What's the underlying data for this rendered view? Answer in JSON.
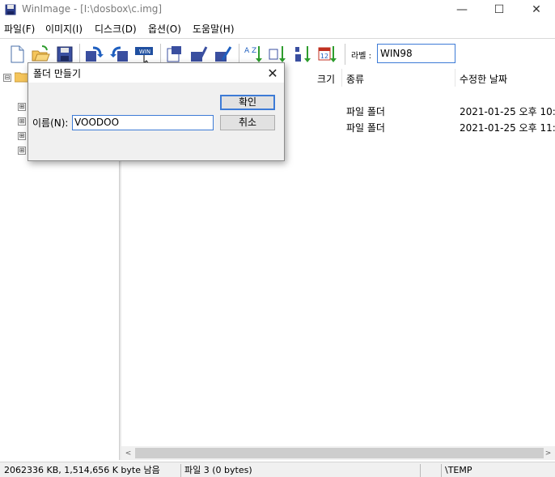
{
  "window": {
    "title": "WinImage - [I:\\dosbox\\c.img]",
    "minimize_glyph": "—",
    "maximize_glyph": "☐",
    "close_glyph": "✕"
  },
  "menu": [
    "파일(F)",
    "이미지(I)",
    "디스크(D)",
    "옵션(O)",
    "도움말(H)"
  ],
  "toolbar": {
    "icons": [
      "new-document-icon",
      "open-folder-icon",
      "save-disk-icon",
      "read-disk-icon",
      "write-disk-icon",
      "format-write-icon",
      "extract-icon",
      "inject-icon",
      "edit-icon",
      "properties-icon",
      "sort-az-icon",
      "sort-type-icon",
      "sort-size-icon",
      "sort-date-icon"
    ],
    "sort_az_text": "A Z",
    "sort_date_text": "12",
    "label_caption": "라벨 :",
    "label_value": "WIN98"
  },
  "list": {
    "columns": {
      "size": "크기",
      "type": "종류",
      "modified": "수정한 날짜"
    },
    "rows": [
      {
        "type": "파일 폴더",
        "modified": "2021-01-25  오후 10:"
      },
      {
        "type": "파일 폴더",
        "modified": "2021-01-25  오후 11:"
      }
    ]
  },
  "tree": {
    "expanders": [
      "⊟",
      "⊞",
      "⊞",
      "⊞",
      "⊞"
    ]
  },
  "scroll": {
    "left_arrow": "<",
    "right_arrow": ">"
  },
  "status": {
    "free_space": "2062336 KB, 1,514,656 K byte 남음",
    "file_count": "파일 3 (0 bytes)",
    "path": "\\TEMP"
  },
  "dialog": {
    "title": "폴더 만들기",
    "close_glyph": "✕",
    "name_label": "이름(N):",
    "name_value": "VOODOO",
    "ok_label": "확인",
    "cancel_label": "취소"
  },
  "colors": {
    "accent": "#3d7bd6",
    "folder": "#f5c55b",
    "toolbar_blue": "#1f5fbf",
    "toolbar_green": "#2e9d2e"
  }
}
